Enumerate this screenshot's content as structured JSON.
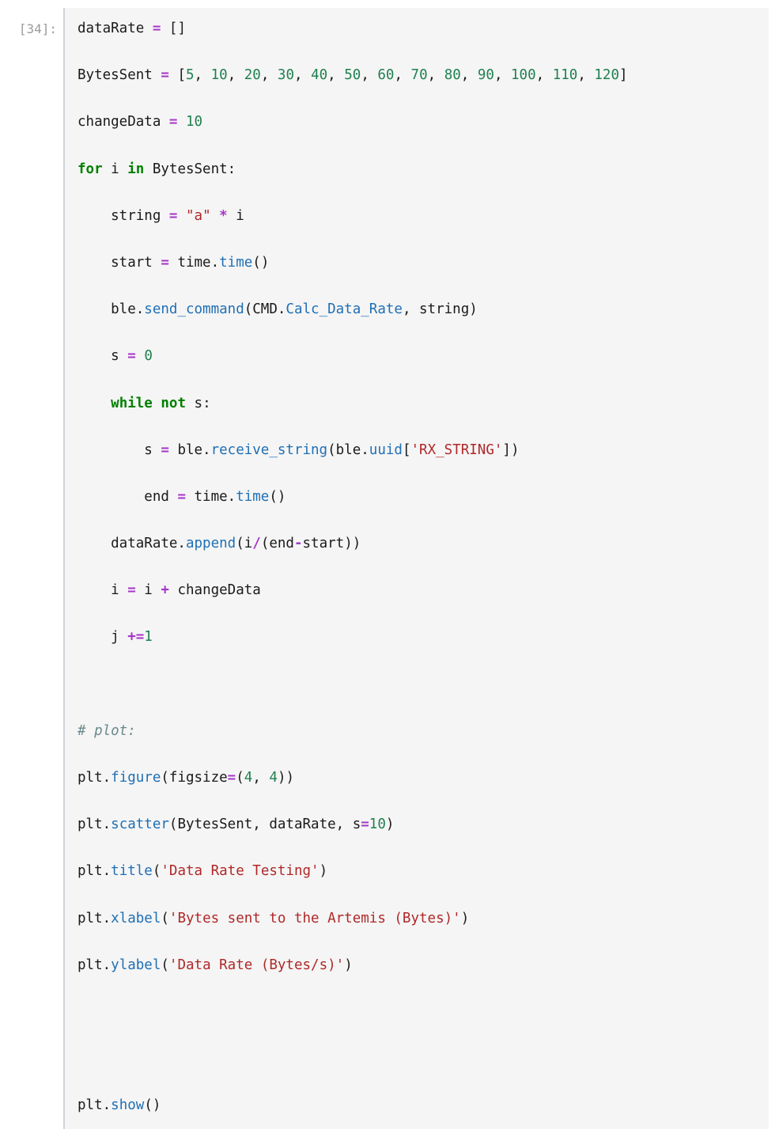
{
  "cell": {
    "prompt": "[34]:",
    "execution_count": 34,
    "language": "python",
    "cell_type": "code",
    "colors": {
      "cell_background": "#f5f5f5",
      "page_background": "#ffffff",
      "prompt_text": "#9b9b9b",
      "left_border": "#cfd4da",
      "plain_text": "#1a1a1a",
      "keyword": "#008000",
      "number": "#208050",
      "string": "#b02828",
      "operator": "#a535c8",
      "function": "#1f6fb5",
      "comment": "#6a8a8a"
    },
    "source_text": "dataRate = []\nBytesSent = [5, 10, 20, 30, 40, 50, 60, 70, 80, 90, 100, 110, 120]\nchangeData = 10\nfor i in BytesSent:\n    string = \"a\" * i\n    start = time.time()\n    ble.send_command(CMD.Calc_Data_Rate, string)\n    s = 0\n    while not s:\n        s = ble.receive_string(ble.uuid['RX_STRING'])\n        end = time.time()\n    dataRate.append(i/(end-start))\n    i = i + changeData\n    j +=1\n\n# plot:\nplt.figure(figsize=(4, 4))\nplt.scatter(BytesSent, dataRate, s=10)\nplt.title('Data Rate Testing')\nplt.xlabel('Bytes sent to the Artemis (Bytes)')\nplt.ylabel('Data Rate (Bytes/s)')\n\n\nplt.show()",
    "lines": [
      [
        {
          "t": "plain",
          "v": "dataRate "
        },
        {
          "t": "op",
          "v": "="
        },
        {
          "t": "plain",
          "v": " []"
        }
      ],
      [
        {
          "t": "plain",
          "v": "BytesSent "
        },
        {
          "t": "op",
          "v": "="
        },
        {
          "t": "plain",
          "v": " ["
        },
        {
          "t": "num",
          "v": "5"
        },
        {
          "t": "plain",
          "v": ", "
        },
        {
          "t": "num",
          "v": "10"
        },
        {
          "t": "plain",
          "v": ", "
        },
        {
          "t": "num",
          "v": "20"
        },
        {
          "t": "plain",
          "v": ", "
        },
        {
          "t": "num",
          "v": "30"
        },
        {
          "t": "plain",
          "v": ", "
        },
        {
          "t": "num",
          "v": "40"
        },
        {
          "t": "plain",
          "v": ", "
        },
        {
          "t": "num",
          "v": "50"
        },
        {
          "t": "plain",
          "v": ", "
        },
        {
          "t": "num",
          "v": "60"
        },
        {
          "t": "plain",
          "v": ", "
        },
        {
          "t": "num",
          "v": "70"
        },
        {
          "t": "plain",
          "v": ", "
        },
        {
          "t": "num",
          "v": "80"
        },
        {
          "t": "plain",
          "v": ", "
        },
        {
          "t": "num",
          "v": "90"
        },
        {
          "t": "plain",
          "v": ", "
        },
        {
          "t": "num",
          "v": "100"
        },
        {
          "t": "plain",
          "v": ", "
        },
        {
          "t": "num",
          "v": "110"
        },
        {
          "t": "plain",
          "v": ", "
        },
        {
          "t": "num",
          "v": "120"
        },
        {
          "t": "plain",
          "v": "]"
        }
      ],
      [
        {
          "t": "plain",
          "v": "changeData "
        },
        {
          "t": "op",
          "v": "="
        },
        {
          "t": "plain",
          "v": " "
        },
        {
          "t": "num",
          "v": "10"
        }
      ],
      [
        {
          "t": "kw",
          "v": "for"
        },
        {
          "t": "plain",
          "v": " i "
        },
        {
          "t": "kw",
          "v": "in"
        },
        {
          "t": "plain",
          "v": " BytesSent:"
        }
      ],
      [
        {
          "t": "plain",
          "v": "    string "
        },
        {
          "t": "op",
          "v": "="
        },
        {
          "t": "plain",
          "v": " "
        },
        {
          "t": "str",
          "v": "\"a\""
        },
        {
          "t": "plain",
          "v": " "
        },
        {
          "t": "op",
          "v": "*"
        },
        {
          "t": "plain",
          "v": " i"
        }
      ],
      [
        {
          "t": "plain",
          "v": "    start "
        },
        {
          "t": "op",
          "v": "="
        },
        {
          "t": "plain",
          "v": " time."
        },
        {
          "t": "fn",
          "v": "time"
        },
        {
          "t": "plain",
          "v": "()"
        }
      ],
      [
        {
          "t": "plain",
          "v": "    ble."
        },
        {
          "t": "fn",
          "v": "send_command"
        },
        {
          "t": "plain",
          "v": "(CMD."
        },
        {
          "t": "attr",
          "v": "Calc_Data_Rate"
        },
        {
          "t": "plain",
          "v": ", string)"
        }
      ],
      [
        {
          "t": "plain",
          "v": "    s "
        },
        {
          "t": "op",
          "v": "="
        },
        {
          "t": "plain",
          "v": " "
        },
        {
          "t": "num",
          "v": "0"
        }
      ],
      [
        {
          "t": "plain",
          "v": "    "
        },
        {
          "t": "kw",
          "v": "while"
        },
        {
          "t": "plain",
          "v": " "
        },
        {
          "t": "kw",
          "v": "not"
        },
        {
          "t": "plain",
          "v": " s:"
        }
      ],
      [
        {
          "t": "plain",
          "v": "        s "
        },
        {
          "t": "op",
          "v": "="
        },
        {
          "t": "plain",
          "v": " ble."
        },
        {
          "t": "fn",
          "v": "receive_string"
        },
        {
          "t": "plain",
          "v": "(ble."
        },
        {
          "t": "attr",
          "v": "uuid"
        },
        {
          "t": "plain",
          "v": "["
        },
        {
          "t": "str",
          "v": "'RX_STRING'"
        },
        {
          "t": "plain",
          "v": "])"
        }
      ],
      [
        {
          "t": "plain",
          "v": "        end "
        },
        {
          "t": "op",
          "v": "="
        },
        {
          "t": "plain",
          "v": " time."
        },
        {
          "t": "fn",
          "v": "time"
        },
        {
          "t": "plain",
          "v": "()"
        }
      ],
      [
        {
          "t": "plain",
          "v": "    dataRate."
        },
        {
          "t": "fn",
          "v": "append"
        },
        {
          "t": "plain",
          "v": "(i"
        },
        {
          "t": "op",
          "v": "/"
        },
        {
          "t": "plain",
          "v": "(end"
        },
        {
          "t": "op",
          "v": "-"
        },
        {
          "t": "plain",
          "v": "start))"
        }
      ],
      [
        {
          "t": "plain",
          "v": "    i "
        },
        {
          "t": "op",
          "v": "="
        },
        {
          "t": "plain",
          "v": " i "
        },
        {
          "t": "op",
          "v": "+"
        },
        {
          "t": "plain",
          "v": " changeData"
        }
      ],
      [
        {
          "t": "plain",
          "v": "    j "
        },
        {
          "t": "op",
          "v": "+="
        },
        {
          "t": "num",
          "v": "1"
        }
      ],
      [],
      [
        {
          "t": "com",
          "v": "# plot:"
        }
      ],
      [
        {
          "t": "plain",
          "v": "plt."
        },
        {
          "t": "fn",
          "v": "figure"
        },
        {
          "t": "plain",
          "v": "(figsize"
        },
        {
          "t": "op",
          "v": "="
        },
        {
          "t": "plain",
          "v": "("
        },
        {
          "t": "num",
          "v": "4"
        },
        {
          "t": "plain",
          "v": ", "
        },
        {
          "t": "num",
          "v": "4"
        },
        {
          "t": "plain",
          "v": "))"
        }
      ],
      [
        {
          "t": "plain",
          "v": "plt."
        },
        {
          "t": "fn",
          "v": "scatter"
        },
        {
          "t": "plain",
          "v": "(BytesSent, dataRate, s"
        },
        {
          "t": "op",
          "v": "="
        },
        {
          "t": "num",
          "v": "10"
        },
        {
          "t": "plain",
          "v": ")"
        }
      ],
      [
        {
          "t": "plain",
          "v": "plt."
        },
        {
          "t": "fn",
          "v": "title"
        },
        {
          "t": "plain",
          "v": "("
        },
        {
          "t": "str",
          "v": "'Data Rate Testing'"
        },
        {
          "t": "plain",
          "v": ")"
        }
      ],
      [
        {
          "t": "plain",
          "v": "plt."
        },
        {
          "t": "fn",
          "v": "xlabel"
        },
        {
          "t": "plain",
          "v": "("
        },
        {
          "t": "str",
          "v": "'Bytes sent to the Artemis (Bytes)'"
        },
        {
          "t": "plain",
          "v": ")"
        }
      ],
      [
        {
          "t": "plain",
          "v": "plt."
        },
        {
          "t": "fn",
          "v": "ylabel"
        },
        {
          "t": "plain",
          "v": "("
        },
        {
          "t": "str",
          "v": "'Data Rate (Bytes/s)'"
        },
        {
          "t": "plain",
          "v": ")"
        }
      ],
      [],
      [],
      [
        {
          "t": "plain",
          "v": "plt."
        },
        {
          "t": "fn",
          "v": "show"
        },
        {
          "t": "plain",
          "v": "()"
        }
      ]
    ]
  }
}
